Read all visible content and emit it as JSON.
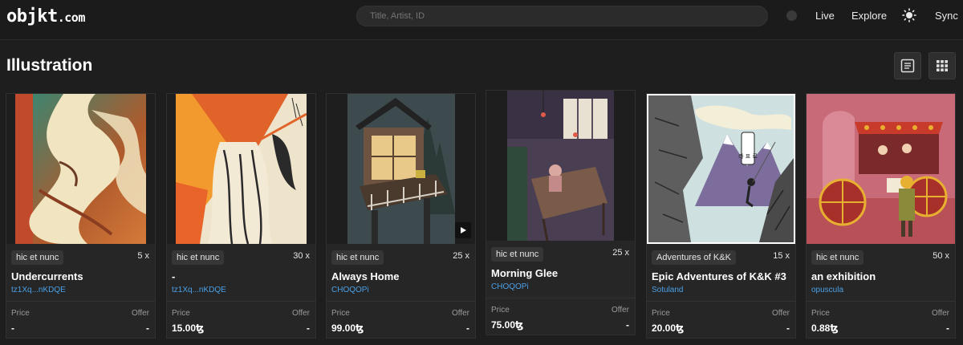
{
  "header": {
    "logo_main": "objkt",
    "logo_suffix": ".com",
    "search_placeholder": "Title, Artist, ID",
    "nav": {
      "live": "Live",
      "explore": "Explore",
      "sync": "Sync"
    }
  },
  "page": {
    "title": "Illustration"
  },
  "price_labels": {
    "price": "Price",
    "offer": "Offer"
  },
  "cards": [
    {
      "platform": "hic et nunc",
      "editions": "5 x",
      "title": "Undercurrents",
      "creator": "tz1Xq...nKDQE",
      "price": "-",
      "offer": "-"
    },
    {
      "platform": "hic et nunc",
      "editions": "30 x",
      "title": "-",
      "creator": "tz1Xq...nKDQE",
      "price": "15.00ꜩ",
      "offer": "-"
    },
    {
      "platform": "hic et nunc",
      "editions": "25 x",
      "title": "Always Home",
      "creator": "CHOQOPi",
      "price": "99.00ꜩ",
      "offer": "-"
    },
    {
      "platform": "hic et nunc",
      "editions": "25 x",
      "title": "Morning Glee",
      "creator": "CHOQOPi",
      "price": "75.00ꜩ",
      "offer": "-"
    },
    {
      "platform": "Adventures of K&K",
      "editions": "15 x",
      "title": "Epic Adventures of K&K #3",
      "creator": "Sotuland",
      "price": "20.00ꜩ",
      "offer": "-"
    },
    {
      "platform": "hic et nunc",
      "editions": "50 x",
      "title": "an exhibition",
      "creator": "opuscula",
      "price": "0.88ꜩ",
      "offer": "-"
    }
  ],
  "artwork_speech_bubble": "라\n표\n로"
}
